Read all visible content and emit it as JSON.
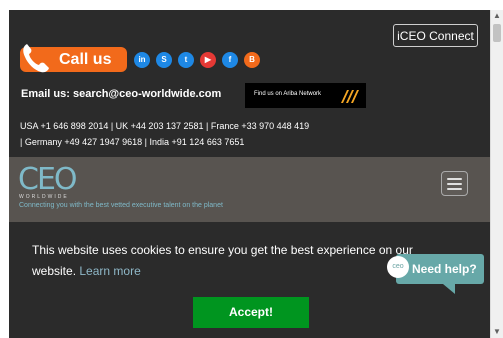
{
  "header": {
    "iceo_label": "iCEO Connect",
    "call_label": "Call us",
    "email_text": "Email us: search@ceo-worldwide.com",
    "ariba_text": "Find us on Ariba Network",
    "phones": [
      "USA +1 646 898 2014 | UK +44 203 137 2581 | France +33 970 448 419",
      "| Germany +49 427 1947 9618 | India +91 124 663 7651"
    ],
    "socials": [
      {
        "icon": "linkedin-icon",
        "glyph": "in",
        "color": "#1e88e5"
      },
      {
        "icon": "skype-icon",
        "glyph": "S",
        "color": "#1e88e5"
      },
      {
        "icon": "twitter-icon",
        "glyph": "t",
        "color": "#1e88e5"
      },
      {
        "icon": "youtube-icon",
        "glyph": "▶",
        "color": "#e53935"
      },
      {
        "icon": "facebook-icon",
        "glyph": "f",
        "color": "#1e88e5"
      },
      {
        "icon": "blogger-icon",
        "glyph": "B",
        "color": "#f26a1b"
      }
    ]
  },
  "brand": {
    "logo": "CEO",
    "logo_sub": "WORLDWIDE",
    "tagline": "Connecting you with the best vetted executive talent on the planet"
  },
  "cookie": {
    "text": "This website uses cookies to ensure you get the best experience on our website.",
    "learn_more": "Learn more",
    "accept": "Accept!"
  },
  "chat": {
    "avatar": "ceo",
    "label": "Need help?"
  },
  "colors": {
    "accent_orange": "#f26a1b",
    "teal": "#67a8a8",
    "accept_green": "#00951f",
    "page_dark": "#2b2b2b",
    "band": "#585450"
  }
}
